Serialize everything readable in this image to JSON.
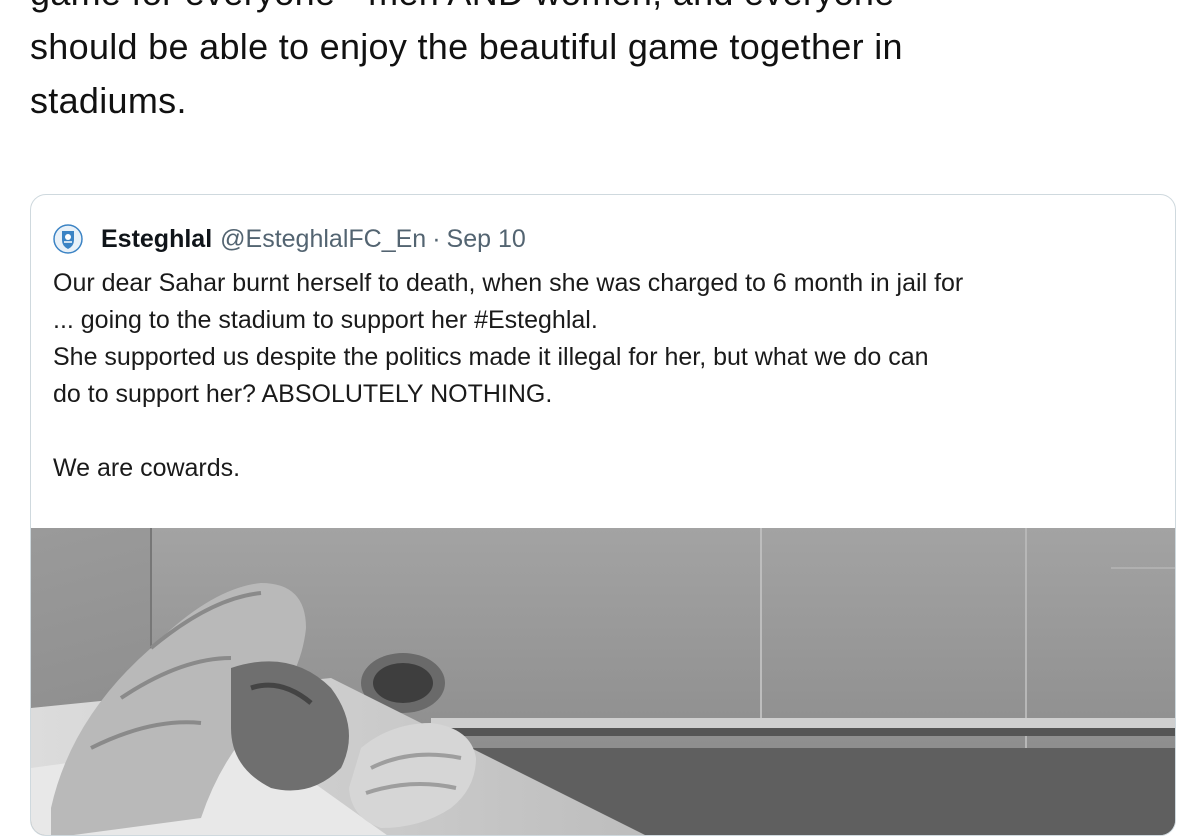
{
  "main_tweet": {
    "lines": [
      "game for everyone - men AND women, and everyone",
      "should be able to enjoy the beautiful game together in",
      "stadiums."
    ]
  },
  "quoted_tweet": {
    "display_name": "Esteghlal",
    "handle": "@EsteghlalFC_En",
    "separator": "·",
    "date": "Sep 10",
    "avatar_icon": "esteghlal-club-crest",
    "text_lines": [
      "Our dear Sahar burnt herself to death, when she was charged to 6 month in jail for",
      "... going to the stadium to support her #Esteghlal.",
      "She supported us despite the politics made it illegal for her, but what we do can",
      "do to support her? ABSOLUTELY NOTHING.",
      "",
      "We are cowards."
    ],
    "media": {
      "kind": "black-and-white photo",
      "tone": "grayscale"
    }
  },
  "colors": {
    "text": "#0f1419",
    "secondary_text": "#536471",
    "border": "#cfd9de",
    "crest_blue": "#3b83c4"
  }
}
